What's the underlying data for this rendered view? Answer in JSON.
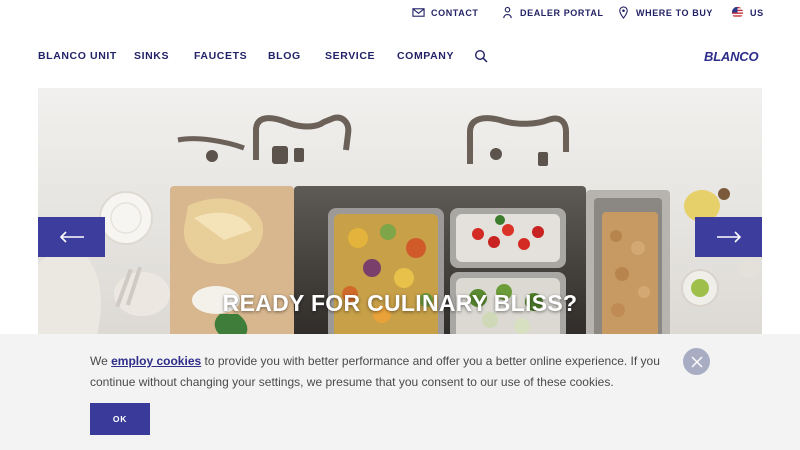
{
  "topbar": {
    "contact": "CONTACT",
    "dealer_portal": "DEALER PORTAL",
    "where_to_buy": "WHERE TO BUY",
    "locale": "US"
  },
  "nav": {
    "items": [
      "BLANCO UNIT",
      "SINKS",
      "FAUCETS",
      "BLOG",
      "SERVICE",
      "COMPANY"
    ],
    "logo": "BLANCO"
  },
  "hero": {
    "headline": "READY FOR CULINARY BLISS?"
  },
  "cookie": {
    "text_before": "We ",
    "link": "employ cookies",
    "text_after": " to provide you with better performance and offer you a better online experience. If you continue without changing your settings, we presume that you consent to our use of these cookies.",
    "ok_label": "OK"
  },
  "colors": {
    "brand": "#2d2d8a",
    "arrow_button": "#3d3d9e",
    "banner_bg": "#f3f3f3",
    "close_bg": "#a9adc3"
  },
  "icons": {
    "contact": "mail-icon",
    "dealer_portal": "person-icon",
    "where_to_buy": "location-pin-icon",
    "locale": "us-flag-icon",
    "search": "search-icon",
    "prev": "arrow-left-icon",
    "next": "arrow-right-icon",
    "close": "close-icon"
  }
}
